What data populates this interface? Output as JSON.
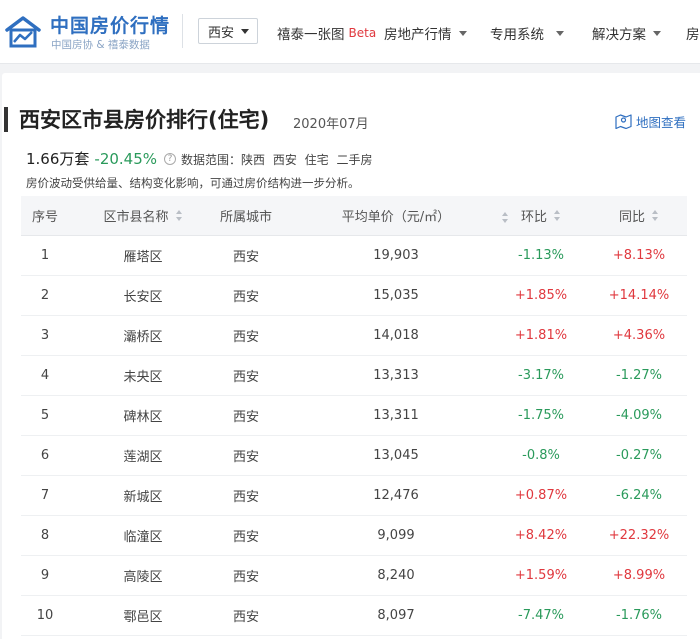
{
  "header": {
    "logo_title": "中国房价行情",
    "logo_subtitle": "中国房协 & 禧泰数据",
    "city": "西安",
    "nav": [
      {
        "label": "禧泰一张图",
        "badge": "Beta"
      },
      {
        "label": "房地产行情"
      },
      {
        "label": "专用系统"
      },
      {
        "label": "解决方案"
      },
      {
        "label": "房"
      }
    ]
  },
  "page": {
    "title": "西安区市县房价排行(住宅)",
    "date": "2020年07月",
    "map_link": "地图查看",
    "summary_price": "1.66万套",
    "summary_change": "-20.45%",
    "scope": "数据范围：陕西  西安  住宅  二手房",
    "note": "房价波动受供给量、结构变化影响，可通过房价结构进一步分析。"
  },
  "table": {
    "headers": {
      "index": "序号",
      "district": "区市县名称",
      "city": "所属城市",
      "price": "平均单价（元/㎡）",
      "mom": "环比",
      "yoy": "同比"
    },
    "rows": [
      {
        "index": "1",
        "district": "雁塔区",
        "city": "西安",
        "price": "19,903",
        "mom": "-1.13%",
        "yoy": "+8.13%"
      },
      {
        "index": "2",
        "district": "长安区",
        "city": "西安",
        "price": "15,035",
        "mom": "+1.85%",
        "yoy": "+14.14%"
      },
      {
        "index": "3",
        "district": "灞桥区",
        "city": "西安",
        "price": "14,018",
        "mom": "+1.81%",
        "yoy": "+4.36%"
      },
      {
        "index": "4",
        "district": "未央区",
        "city": "西安",
        "price": "13,313",
        "mom": "-3.17%",
        "yoy": "-1.27%"
      },
      {
        "index": "5",
        "district": "碑林区",
        "city": "西安",
        "price": "13,311",
        "mom": "-1.75%",
        "yoy": "-4.09%"
      },
      {
        "index": "6",
        "district": "莲湖区",
        "city": "西安",
        "price": "13,045",
        "mom": "-0.8%",
        "yoy": "-0.27%"
      },
      {
        "index": "7",
        "district": "新城区",
        "city": "西安",
        "price": "12,476",
        "mom": "+0.87%",
        "yoy": "-6.24%"
      },
      {
        "index": "8",
        "district": "临潼区",
        "city": "西安",
        "price": "9,099",
        "mom": "+8.42%",
        "yoy": "+22.32%"
      },
      {
        "index": "9",
        "district": "高陵区",
        "city": "西安",
        "price": "8,240",
        "mom": "+1.59%",
        "yoy": "+8.99%"
      },
      {
        "index": "10",
        "district": "鄠邑区",
        "city": "西安",
        "price": "8,097",
        "mom": "-7.47%",
        "yoy": "-1.76%"
      }
    ]
  },
  "colors": {
    "brand": "#2f6fc0",
    "up": "#e0383e",
    "down": "#2a9a5b"
  },
  "icons": {
    "logo": "house-chart-icon",
    "map": "map-pin-icon",
    "help": "question-circle-icon",
    "dropdown": "caret-down-icon",
    "sort": "sort-icon"
  }
}
